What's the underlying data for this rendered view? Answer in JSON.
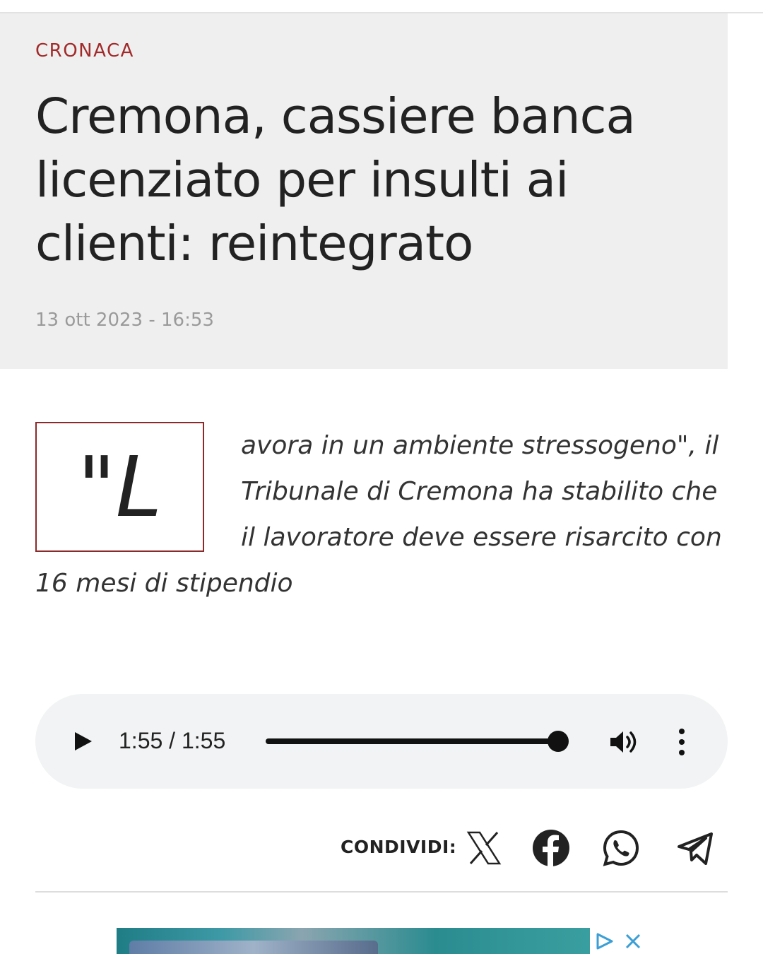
{
  "article": {
    "category": "CRONACA",
    "headline": "Cremona, cassiere banca licenziato per insulti ai clienti: reintegrato",
    "date": "13 ott 2023 - 16:53",
    "dropcap": "\"L",
    "lead_lines": [
      "avora in un ambiente stressogeno\", il",
      "Tribunale di Cremona ha stabilito che",
      "il lavoratore deve essere risarcito con",
      "16 mesi di stipendio"
    ]
  },
  "audio_player": {
    "time": "1:55 / 1:55",
    "progress": 1.0
  },
  "share": {
    "label": "CONDIVIDI:",
    "icons": [
      "x-icon",
      "facebook-icon",
      "whatsapp-icon",
      "telegram-icon"
    ]
  },
  "colors": {
    "accent": "#a12a2a",
    "header_bg": "#efefef",
    "player_bg": "#f1f3f4"
  }
}
